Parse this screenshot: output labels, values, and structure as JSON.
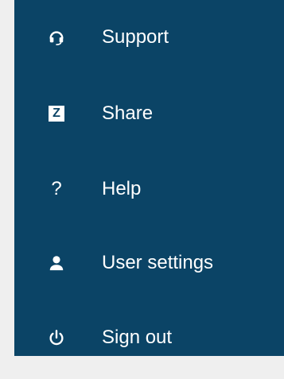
{
  "theme": {
    "background": "#efefef",
    "menu_background": "#0b4466",
    "text_color": "#ffffff"
  },
  "menu": {
    "items": [
      {
        "label": "Support",
        "icon": "headset-icon"
      },
      {
        "label": "Share",
        "icon": "z-icon",
        "icon_text": "Z"
      },
      {
        "label": "Help",
        "icon": "help-icon",
        "icon_text": "?"
      },
      {
        "label": "User settings",
        "icon": "user-icon"
      },
      {
        "label": "Sign out",
        "icon": "power-icon"
      }
    ]
  }
}
